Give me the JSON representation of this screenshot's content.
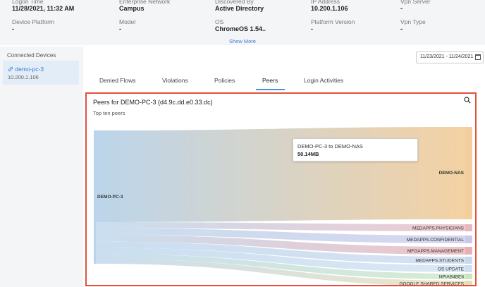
{
  "info": {
    "row1": [
      {
        "label": "Logon Time",
        "value": "11/28/2021, 11:32 AM"
      },
      {
        "label": "Enterprise Network",
        "value": "Campus"
      },
      {
        "label": "Discovered By",
        "value": "Active Directory"
      },
      {
        "label": "IP Address",
        "value": "10.200.1.106"
      },
      {
        "label": "Vpn Server",
        "value": "-"
      }
    ],
    "row2": [
      {
        "label": "Device Platform",
        "value": "-"
      },
      {
        "label": "Model",
        "value": "-"
      },
      {
        "label": "OS",
        "value": "ChromeOS 1.54.."
      },
      {
        "label": "Platform Version",
        "value": "-"
      },
      {
        "label": "Vpn Type",
        "value": "-"
      }
    ],
    "show_more": "Show More"
  },
  "sidebar": {
    "title": "Connected Devices",
    "device": {
      "name": "demo-pc-3",
      "ip": "10.200.1.106"
    }
  },
  "date_range": "11/23/2021 - 11/24/2021",
  "tabs": [
    {
      "label": "Denied Flows"
    },
    {
      "label": "Violations"
    },
    {
      "label": "Policies"
    },
    {
      "label": "Peers"
    },
    {
      "label": "Login Activities"
    }
  ],
  "active_tab": "Peers",
  "panel": {
    "title": "Peers for  DEMO-PC-3 (d4.9c.dd.e0.33.dc)",
    "subtitle": "Top ten peers"
  },
  "tooltip": {
    "title": "DEMO-PC-3 to DEMO-NAS",
    "value": "50.14MB"
  },
  "chart_data": {
    "type": "sankey",
    "source": "DEMO-PC-3",
    "targets": [
      {
        "name": "DEMO-NAS",
        "color": "#f3cf9e"
      },
      {
        "name": "MEDAPPS.PHYSICIANS",
        "color": "#e9b8bf"
      },
      {
        "name": "MEDAPPS.CONFIDENTIAL",
        "color": "#c8c8ea"
      },
      {
        "name": "MFGAPPS.MANAGEMENT",
        "color": "#e8b0b6"
      },
      {
        "name": "MEDAPPS.STUDENTS",
        "color": "#c9d8ee"
      },
      {
        "name": "OS UPDATE",
        "color": "#cfe0f2"
      },
      {
        "name": "NPIAB4BE8",
        "color": "#c9e6c2"
      },
      {
        "name": "GOOGLE SHARED SERVICES",
        "color": "#e6ddb3"
      }
    ],
    "source_color": "#b8d3ea"
  }
}
